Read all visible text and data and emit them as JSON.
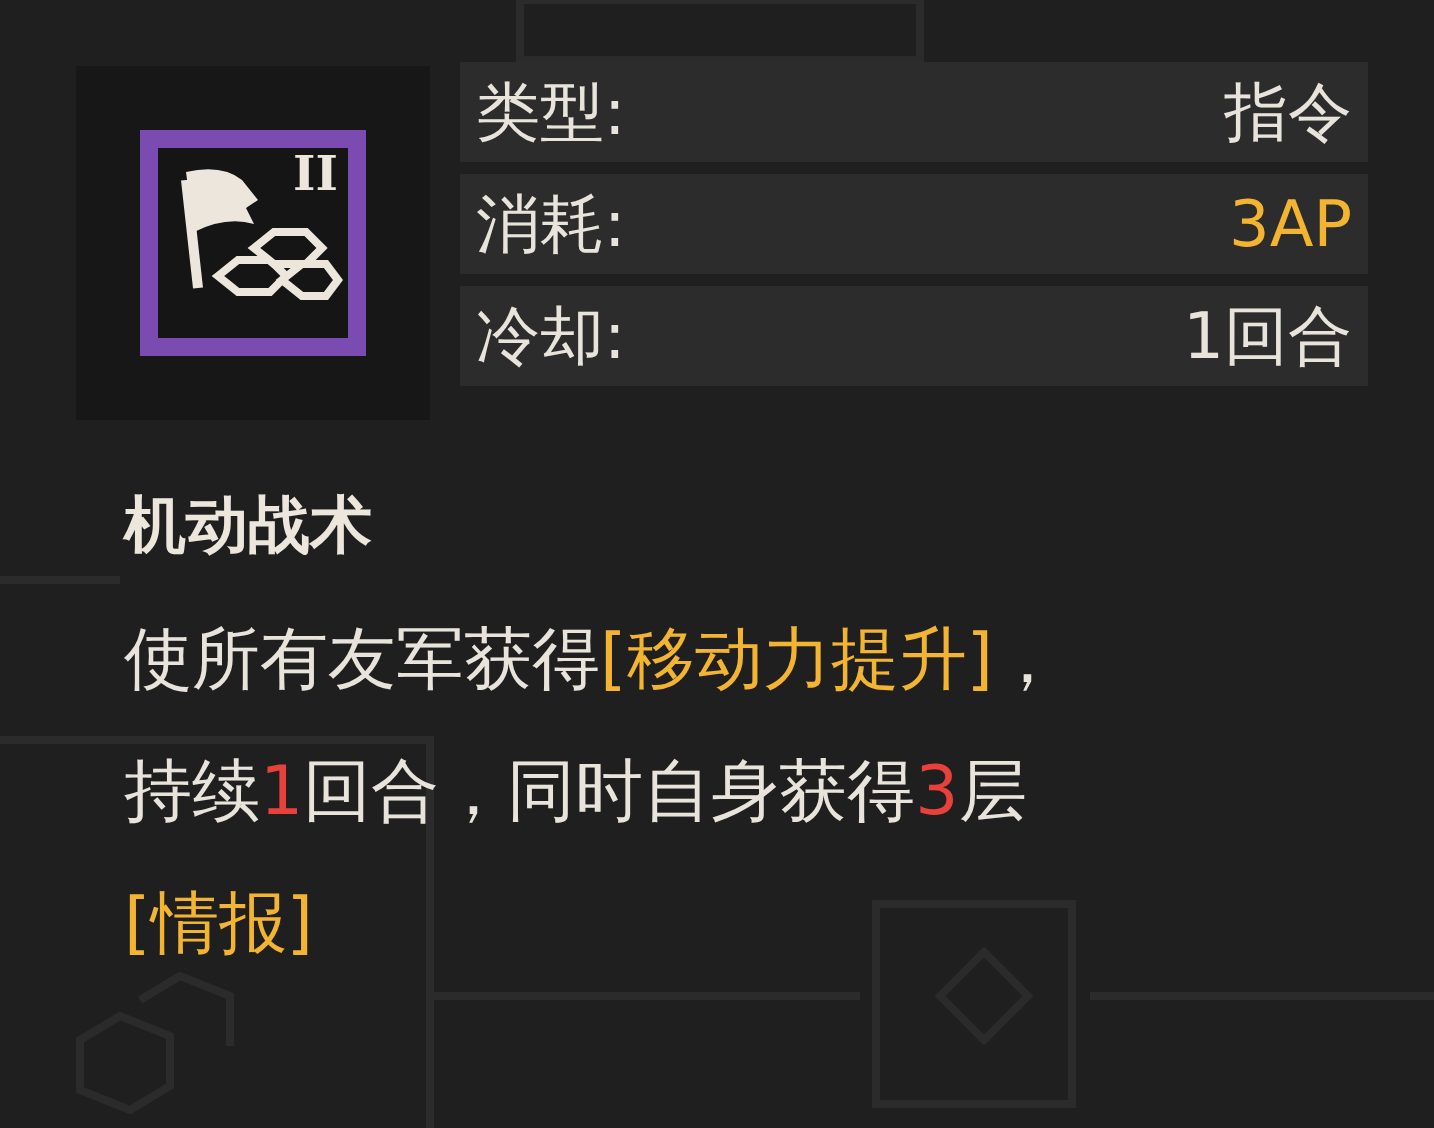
{
  "skill": {
    "rank": "II",
    "stats": [
      {
        "label": "类型:",
        "value": "指令",
        "highlight": false
      },
      {
        "label": "消耗:",
        "value": "3AP",
        "highlight": true
      },
      {
        "label": "冷却:",
        "value": "1回合",
        "highlight": false
      }
    ],
    "name": "机动战术",
    "description": [
      [
        {
          "kind": "text",
          "text": "使所有友军获得"
        },
        {
          "kind": "keyword",
          "text": "[移动力提升]"
        },
        {
          "kind": "text",
          "text": "，"
        }
      ],
      [
        {
          "kind": "text",
          "text": "持续"
        },
        {
          "kind": "number",
          "text": "1"
        },
        {
          "kind": "text",
          "text": "回合，同时自身获得"
        },
        {
          "kind": "number",
          "text": "3"
        },
        {
          "kind": "text",
          "text": "层"
        }
      ],
      [
        {
          "kind": "keyword",
          "text": "[情报]"
        }
      ]
    ]
  }
}
